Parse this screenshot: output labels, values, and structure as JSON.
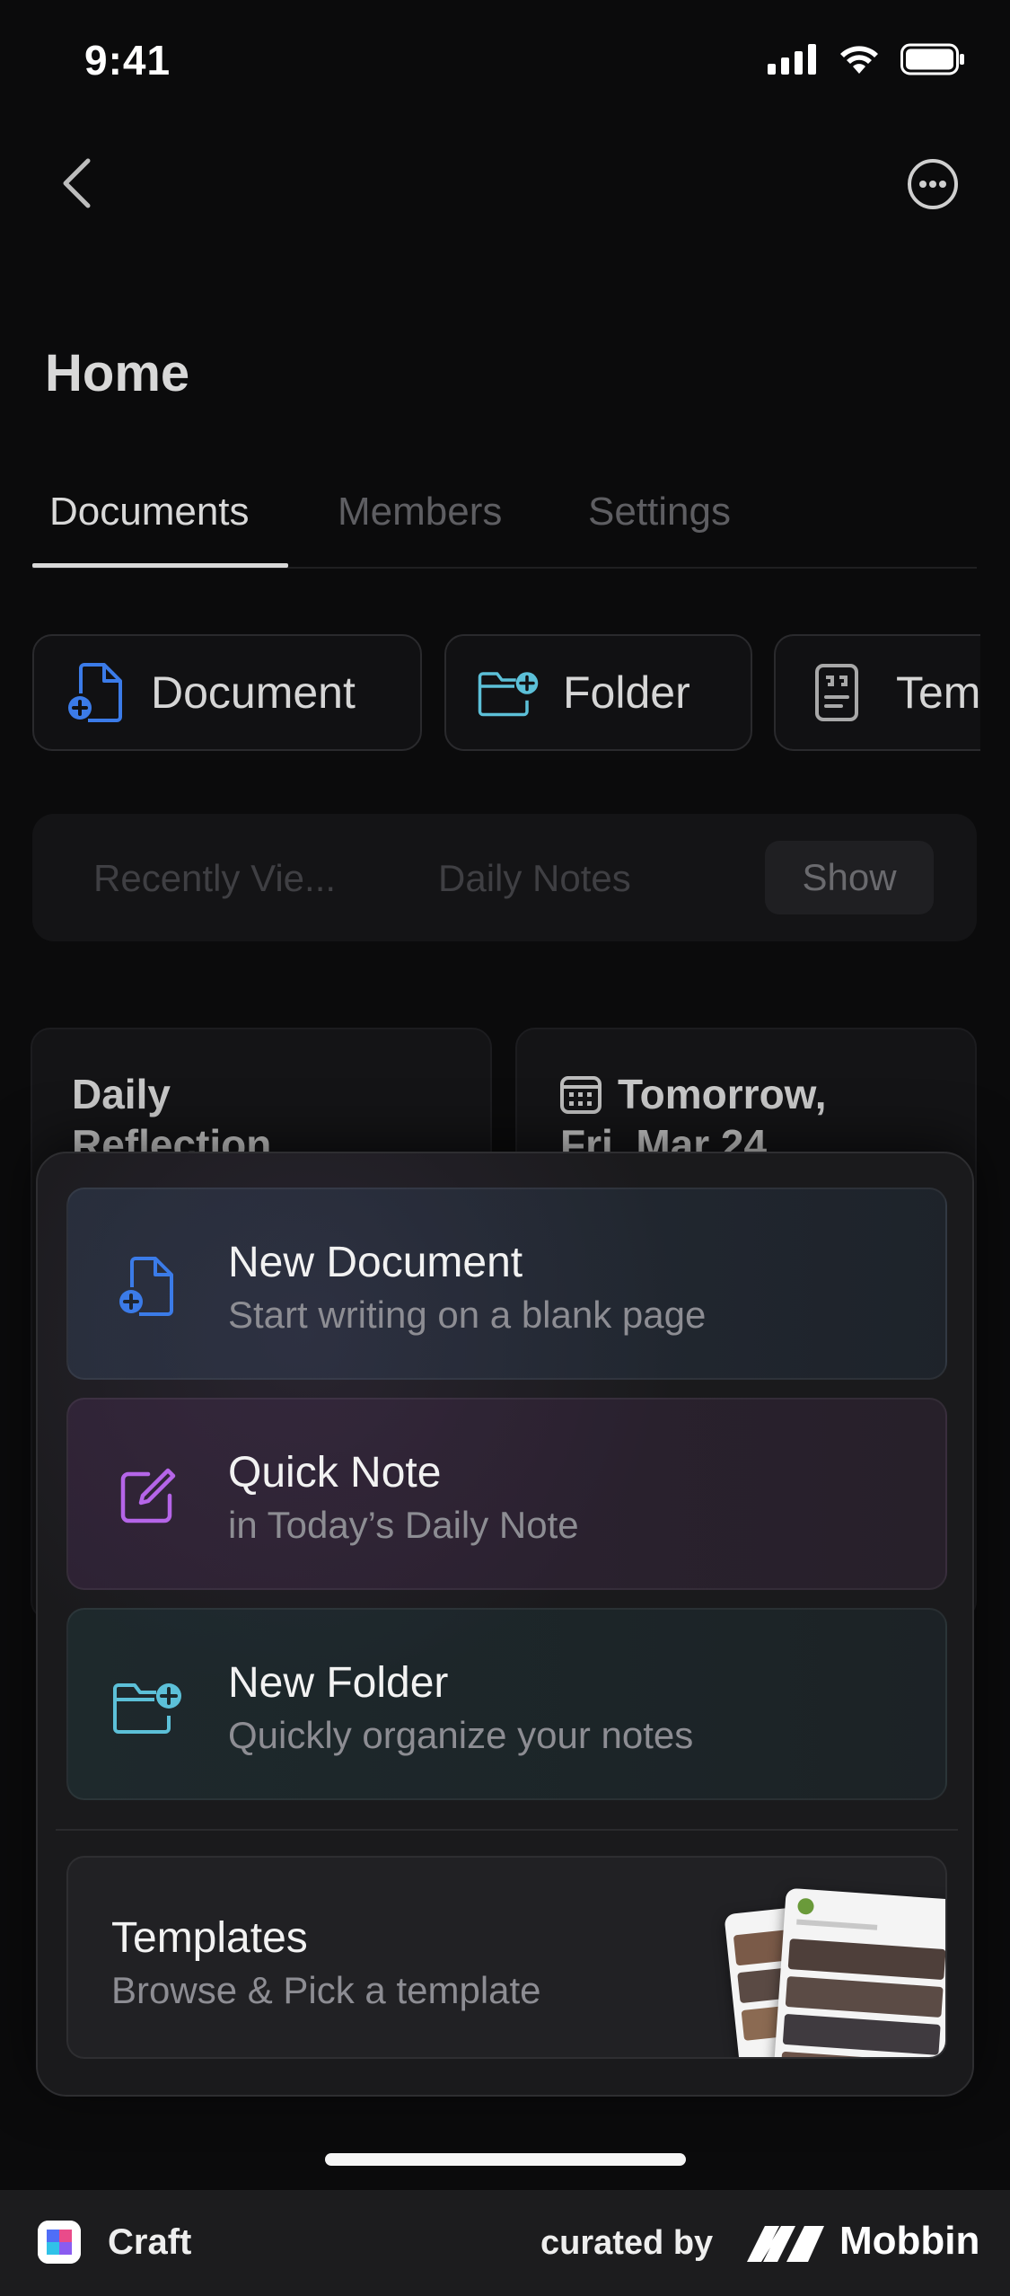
{
  "status_bar": {
    "time": "9:41"
  },
  "header": {
    "title": "Home"
  },
  "tabs": [
    {
      "label": "Documents",
      "active": true
    },
    {
      "label": "Members",
      "active": false
    },
    {
      "label": "Settings",
      "active": false
    }
  ],
  "quick_actions": [
    {
      "label": "Document",
      "icon": "add-document-icon"
    },
    {
      "label": "Folder",
      "icon": "add-folder-icon"
    },
    {
      "label": "Tem",
      "icon": "template-icon"
    }
  ],
  "segments": {
    "items": [
      "Recently Vie...",
      "Daily Notes"
    ],
    "show_label": "Show"
  },
  "cards": [
    {
      "title_line1": "Daily",
      "title_line2": "Reflection"
    },
    {
      "title_line1": "Tomorrow,",
      "title_line2": "Fri, Mar 24",
      "icon": "calendar-icon"
    }
  ],
  "menu": {
    "items": [
      {
        "title": "New Document",
        "subtitle": "Start writing on a blank page",
        "icon": "add-document-icon"
      },
      {
        "title": "Quick Note",
        "subtitle": "in Today’s Daily Note",
        "icon": "edit-note-icon"
      },
      {
        "title": "New Folder",
        "subtitle": "Quickly organize your notes",
        "icon": "add-folder-icon"
      }
    ],
    "templates": {
      "title": "Templates",
      "subtitle": "Browse & Pick a template"
    }
  },
  "footer": {
    "app_name": "Craft",
    "curated_by": "curated by",
    "brand": "Mobbin"
  },
  "colors": {
    "doc_icon": "#3b7be8",
    "note_icon": "#b565e8",
    "folder_icon": "#5cc0d8"
  }
}
